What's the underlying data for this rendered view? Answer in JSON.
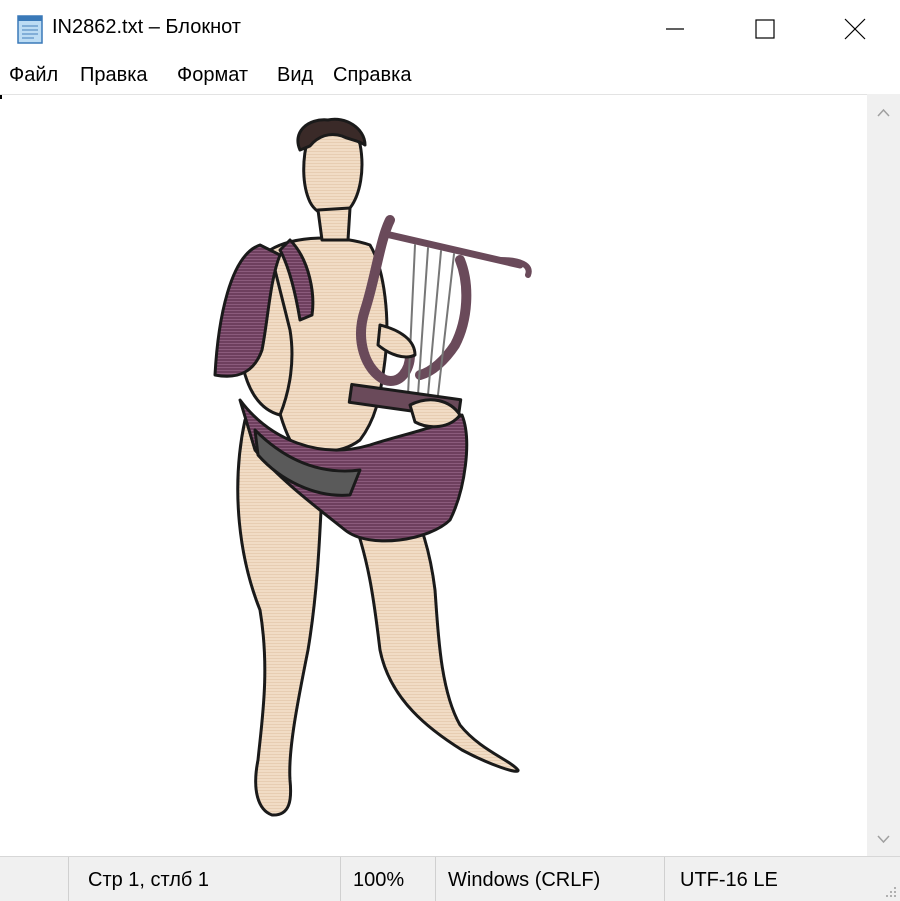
{
  "window": {
    "title": "IN2862.txt – Блокнот",
    "icon": "notepad-icon",
    "controls": [
      "minimize-icon",
      "maximize-icon",
      "close-icon"
    ]
  },
  "menu": {
    "items": [
      "Файл",
      "Правка",
      "Формат",
      "Вид",
      "Справка"
    ]
  },
  "editor": {
    "content": "ASCII-art illustration of Apollo with a lyre"
  },
  "statusbar": {
    "position": "Стр 1, стлб 1",
    "zoom": "100%",
    "line_endings": "Windows (CRLF)",
    "encoding": "UTF-16 LE"
  },
  "colors": {
    "skin": "#f1dcc5",
    "cloth_purple": "#6e3f5e",
    "cloth_gray": "#5a5a5a",
    "outline": "#1a1a1a",
    "lyre": "#6a4a5a"
  }
}
